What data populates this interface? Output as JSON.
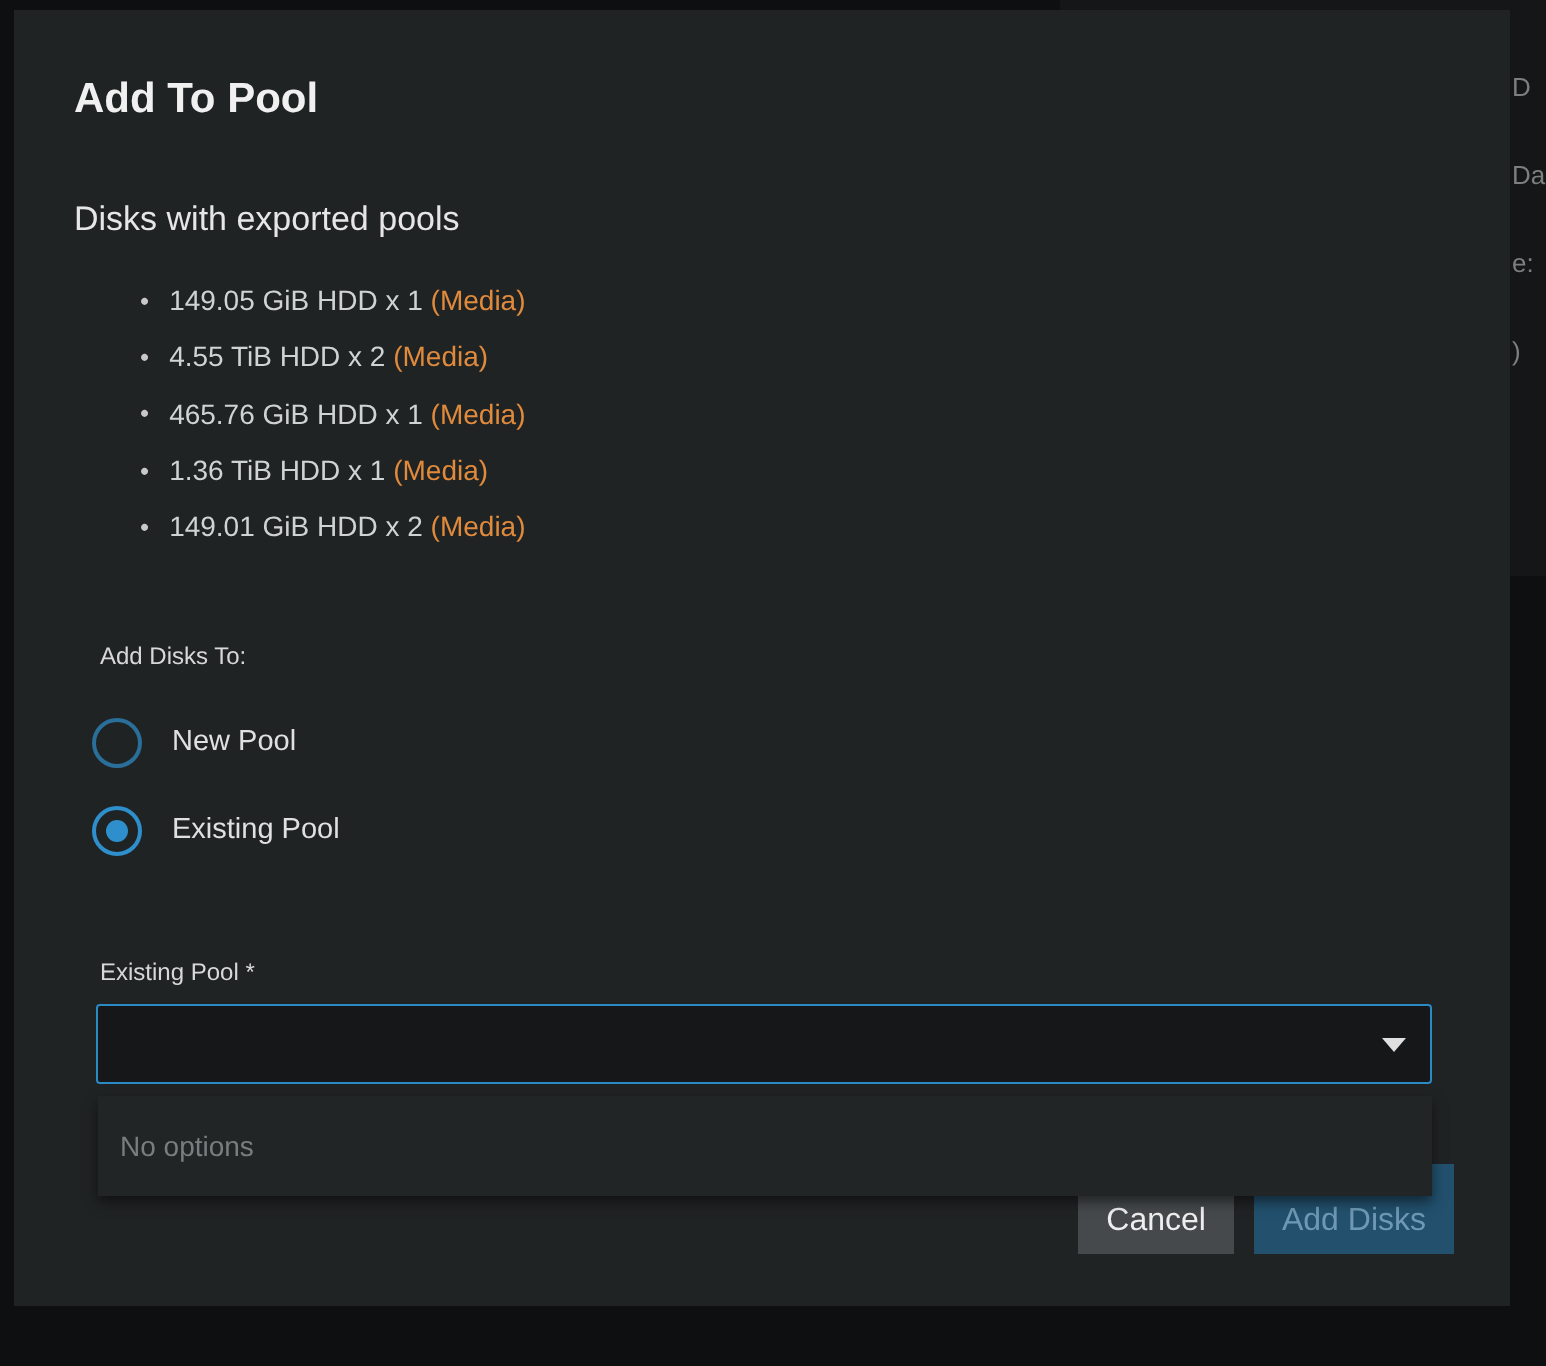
{
  "background": {
    "fragments": [
      "D",
      "Da",
      "e:",
      ")"
    ]
  },
  "dialog": {
    "title": "Add To Pool",
    "subtitle": "Disks with exported pools",
    "disks": [
      {
        "bullet": "•",
        "text": "149.05 GiB HDD x 1",
        "pool": "(Media)"
      },
      {
        "bullet": "•",
        "text": "4.55 TiB HDD x 2",
        "pool": "(Media)"
      },
      {
        "bullet": "•",
        "text": "465.76 GiB HDD x 1",
        "pool": "(Media)"
      },
      {
        "bullet": "•",
        "text": "1.36 TiB HDD x 1",
        "pool": "(Media)"
      },
      {
        "bullet": "•",
        "text": "149.01 GiB HDD x 2",
        "pool": "(Media)"
      }
    ],
    "radio_label": "Add Disks To:",
    "options": [
      {
        "label": "New Pool",
        "selected": false
      },
      {
        "label": "Existing Pool",
        "selected": true
      }
    ],
    "select": {
      "label": "Existing Pool *",
      "menu_text": "No options"
    },
    "buttons": [
      {
        "label": "Cancel",
        "kind": "secondary"
      },
      {
        "label": "Add Disks",
        "kind": "primary"
      }
    ]
  }
}
